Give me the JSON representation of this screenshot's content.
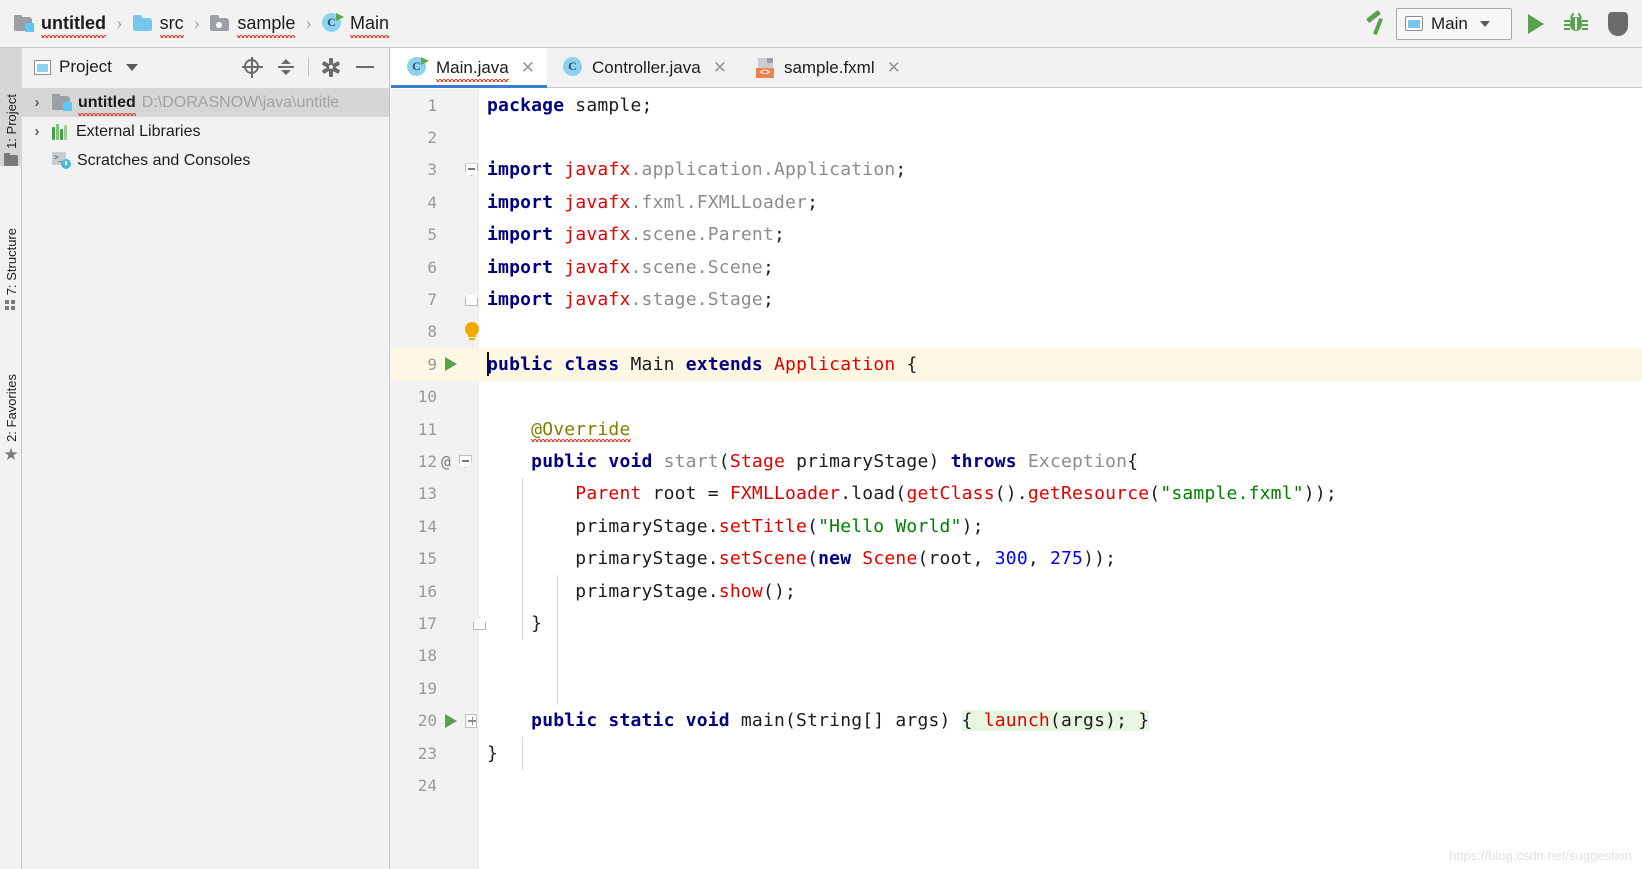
{
  "breadcrumb": {
    "items": [
      {
        "label": "untitled",
        "icon": "project-folder-icon",
        "bold": true,
        "squiggly": true
      },
      {
        "label": "src",
        "icon": "folder-icon",
        "bold": false,
        "squiggly": true
      },
      {
        "label": "sample",
        "icon": "package-folder-icon",
        "bold": false,
        "squiggly": true
      },
      {
        "label": "Main",
        "icon": "java-class-icon",
        "bold": false,
        "squiggly": true
      }
    ],
    "separator": "›"
  },
  "toolbar": {
    "build_label": "Build Project",
    "run_config_name": "Main",
    "run_label": "Run",
    "debug_label": "Debug",
    "coverage_label": "Run with Coverage"
  },
  "tool_strip": {
    "items": [
      {
        "label": "1: Project",
        "icon": "project-icon",
        "active": true
      },
      {
        "label": "7: Structure",
        "icon": "structure-icon",
        "active": false
      },
      {
        "label": "2: Favorites",
        "icon": "star-icon",
        "active": false
      }
    ]
  },
  "project_panel": {
    "title": "Project",
    "actions": [
      {
        "name": "locate-icon",
        "label": "Select Opened File"
      },
      {
        "name": "collapse-all-icon",
        "label": "Collapse All"
      },
      {
        "name": "gear-icon",
        "label": "Settings"
      },
      {
        "name": "minimize-icon",
        "label": "Hide"
      }
    ],
    "tree": [
      {
        "label": "untitled",
        "path": "D:\\DORASNOW\\java\\untitle",
        "icon": "project-folder-icon",
        "arrow": "›",
        "bold": true,
        "selected": true,
        "squiggly": true
      },
      {
        "label": "External Libraries",
        "path": "",
        "icon": "library-icon",
        "arrow": "›",
        "bold": false,
        "selected": false,
        "squiggly": false
      },
      {
        "label": "Scratches and Consoles",
        "path": "",
        "icon": "scratch-icon",
        "arrow": "",
        "bold": false,
        "selected": false,
        "squiggly": false
      }
    ]
  },
  "editor": {
    "tabs": [
      {
        "label": "Main.java",
        "icon": "java-class-icon",
        "active": true,
        "closable": true,
        "squiggly": true
      },
      {
        "label": "Controller.java",
        "icon": "java-class-icon-plain",
        "active": false,
        "closable": true,
        "squiggly": false
      },
      {
        "label": "sample.fxml",
        "icon": "fxml-icon",
        "active": false,
        "closable": true,
        "squiggly": false
      }
    ],
    "close_glyph": "✕",
    "lines": [
      {
        "num": "1",
        "gutter": "",
        "current": false
      },
      {
        "num": "2",
        "gutter": "",
        "current": false
      },
      {
        "num": "3",
        "gutter": "fold-top",
        "current": false
      },
      {
        "num": "4",
        "gutter": "",
        "current": false
      },
      {
        "num": "5",
        "gutter": "",
        "current": false
      },
      {
        "num": "6",
        "gutter": "",
        "current": false
      },
      {
        "num": "7",
        "gutter": "fold-bot",
        "current": false
      },
      {
        "num": "8",
        "gutter": "bulb",
        "current": false
      },
      {
        "num": "9",
        "gutter": "run",
        "current": true
      },
      {
        "num": "10",
        "gutter": "",
        "current": false
      },
      {
        "num": "11",
        "gutter": "",
        "current": false
      },
      {
        "num": "12",
        "gutter": "at-fold",
        "current": false
      },
      {
        "num": "13",
        "gutter": "",
        "current": false
      },
      {
        "num": "14",
        "gutter": "",
        "current": false
      },
      {
        "num": "15",
        "gutter": "",
        "current": false
      },
      {
        "num": "16",
        "gutter": "",
        "current": false
      },
      {
        "num": "17",
        "gutter": "fold-bot",
        "current": false
      },
      {
        "num": "18",
        "gutter": "",
        "current": false
      },
      {
        "num": "19",
        "gutter": "",
        "current": false
      },
      {
        "num": "20",
        "gutter": "run-plus",
        "current": false
      },
      {
        "num": "23",
        "gutter": "",
        "current": false
      },
      {
        "num": "24",
        "gutter": "",
        "current": false
      }
    ],
    "code_text": [
      "package sample;",
      "",
      "import javafx.application.Application;",
      "import javafx.fxml.FXMLLoader;",
      "import javafx.scene.Parent;",
      "import javafx.scene.Scene;",
      "import javafx.stage.Stage;",
      "",
      "public class Main extends Application {",
      "",
      "    @Override",
      "    public void start(Stage primaryStage) throws Exception{",
      "        Parent root = FXMLLoader.load(getClass().getResource(\"sample.fxml\"));",
      "        primaryStage.setTitle(\"Hello World\");",
      "        primaryStage.setScene(new Scene(root, 300, 275));",
      "        primaryStage.show();",
      "    }",
      "",
      "",
      "    public static void main(String[] args) { launch(args); }",
      "}",
      ""
    ]
  },
  "watermark": "https://blog.csdn.net/suggestion",
  "colors": {
    "keyword": "#000080",
    "error": "#e00000",
    "string": "#008000",
    "number": "#0000ff",
    "annotation": "#808000",
    "gray_text": "#8c8c8c",
    "accent_green": "#59a14f",
    "tab_underline": "#3a7ecf",
    "current_line": "#fdf8e3",
    "fold_highlight": "#e8f5e1"
  }
}
